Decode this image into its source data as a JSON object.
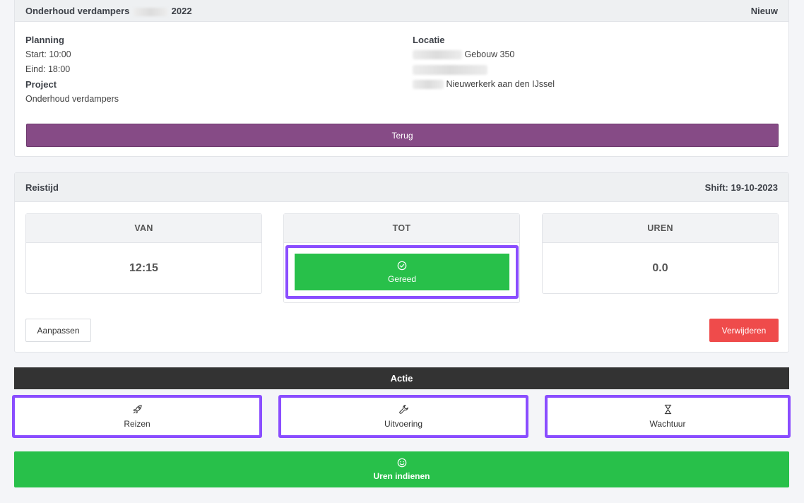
{
  "job_card": {
    "title_prefix": "Onderhoud verdampers",
    "title_year": "2022",
    "status": "Nieuw",
    "planning_label": "Planning",
    "start": "Start: 10:00",
    "end": "Eind: 18:00",
    "project_label": "Project",
    "project_value": "Onderhoud verdampers",
    "location_label": "Locatie",
    "location_building": "Gebouw 350",
    "location_city": "Nieuwerkerk aan den IJssel",
    "back_label": "Terug"
  },
  "travel_card": {
    "title": "Reistijd",
    "shift": "Shift: 19-10-2023",
    "van_label": "VAN",
    "van_value": "12:15",
    "tot_label": "TOT",
    "done_label": "Gereed",
    "uren_label": "UREN",
    "uren_value": "0.0",
    "edit_label": "Aanpassen",
    "delete_label": "Verwijderen"
  },
  "actions": {
    "header": "Actie",
    "travel": "Reizen",
    "execution": "Uitvoering",
    "waiting": "Wachtuur",
    "submit": "Uren indienen"
  },
  "colors": {
    "purple_button": "#864b86",
    "green": "#28c04a",
    "red": "#ef4b4b",
    "highlight": "#8a4dff",
    "dark_bar": "#333333"
  },
  "icons": {
    "done": "check-circle-icon",
    "travel": "rocket-icon",
    "execution": "wrench-icon",
    "waiting": "hourglass-icon",
    "submit": "smile-icon"
  }
}
